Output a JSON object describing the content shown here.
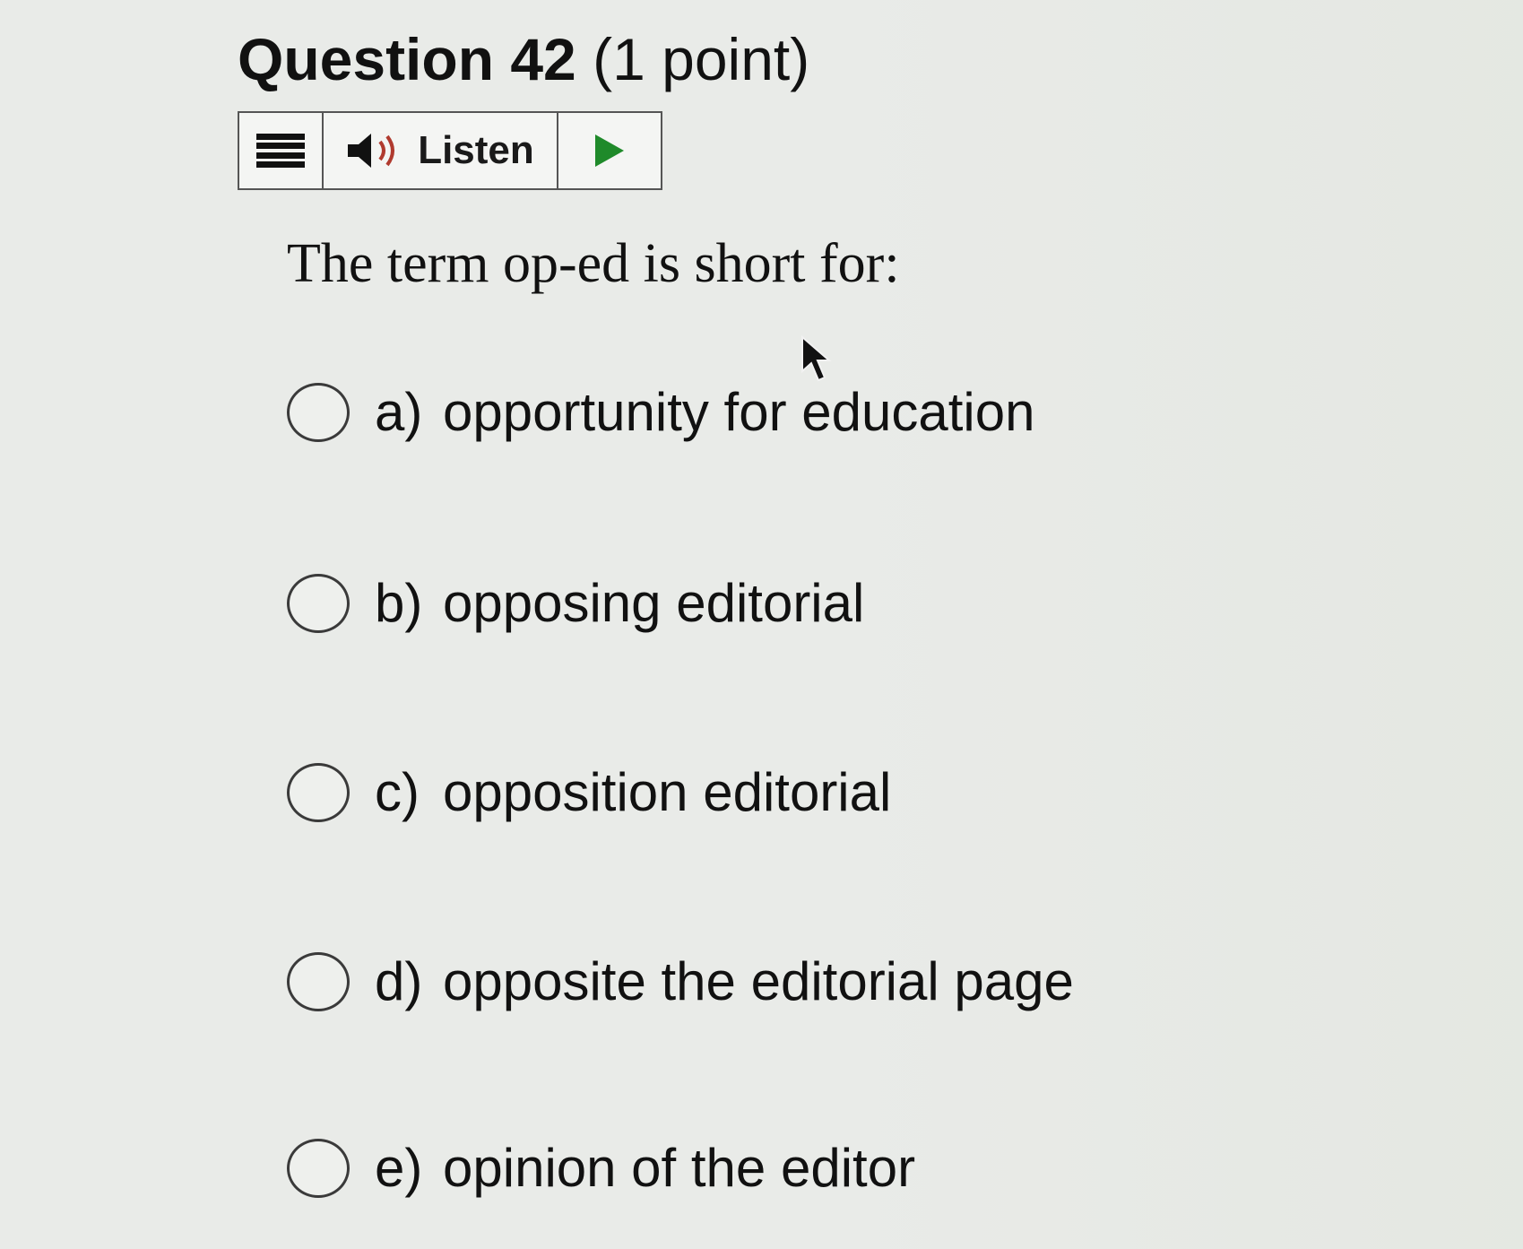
{
  "question": {
    "number_label": "Question 42",
    "points_label": "(1 point)",
    "prompt": "The term op-ed is short for:"
  },
  "listen_toolbar": {
    "menu_icon": "hamburger-menu-icon",
    "speaker_icon": "speaker-icon",
    "listen_label": "Listen",
    "play_icon": "play-icon",
    "play_color": "#1f8a2a"
  },
  "options": [
    {
      "letter": "a)",
      "text": "opportunity for education",
      "selected": false
    },
    {
      "letter": "b)",
      "text": "opposing editorial",
      "selected": false
    },
    {
      "letter": "c)",
      "text": "opposition editorial",
      "selected": false
    },
    {
      "letter": "d)",
      "text": "opposite the editorial page",
      "selected": false
    },
    {
      "letter": "e)",
      "text": "opinion of the editor",
      "selected": false
    }
  ]
}
